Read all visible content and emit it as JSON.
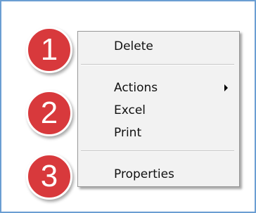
{
  "context_menu": {
    "items": [
      {
        "label": "Delete"
      },
      {
        "label": "Actions",
        "has_submenu": true,
        "arrow_icon": "submenu-arrow-icon"
      },
      {
        "label": "Excel"
      },
      {
        "label": "Print"
      },
      {
        "label": "Properties"
      }
    ]
  },
  "callouts": [
    {
      "number": "1"
    },
    {
      "number": "2"
    },
    {
      "number": "3"
    }
  ],
  "colors": {
    "frame_border": "#6b9ed2",
    "menu_background": "#f2f2f2",
    "callout_fill": "#d8393c",
    "callout_text": "#ffffff"
  }
}
